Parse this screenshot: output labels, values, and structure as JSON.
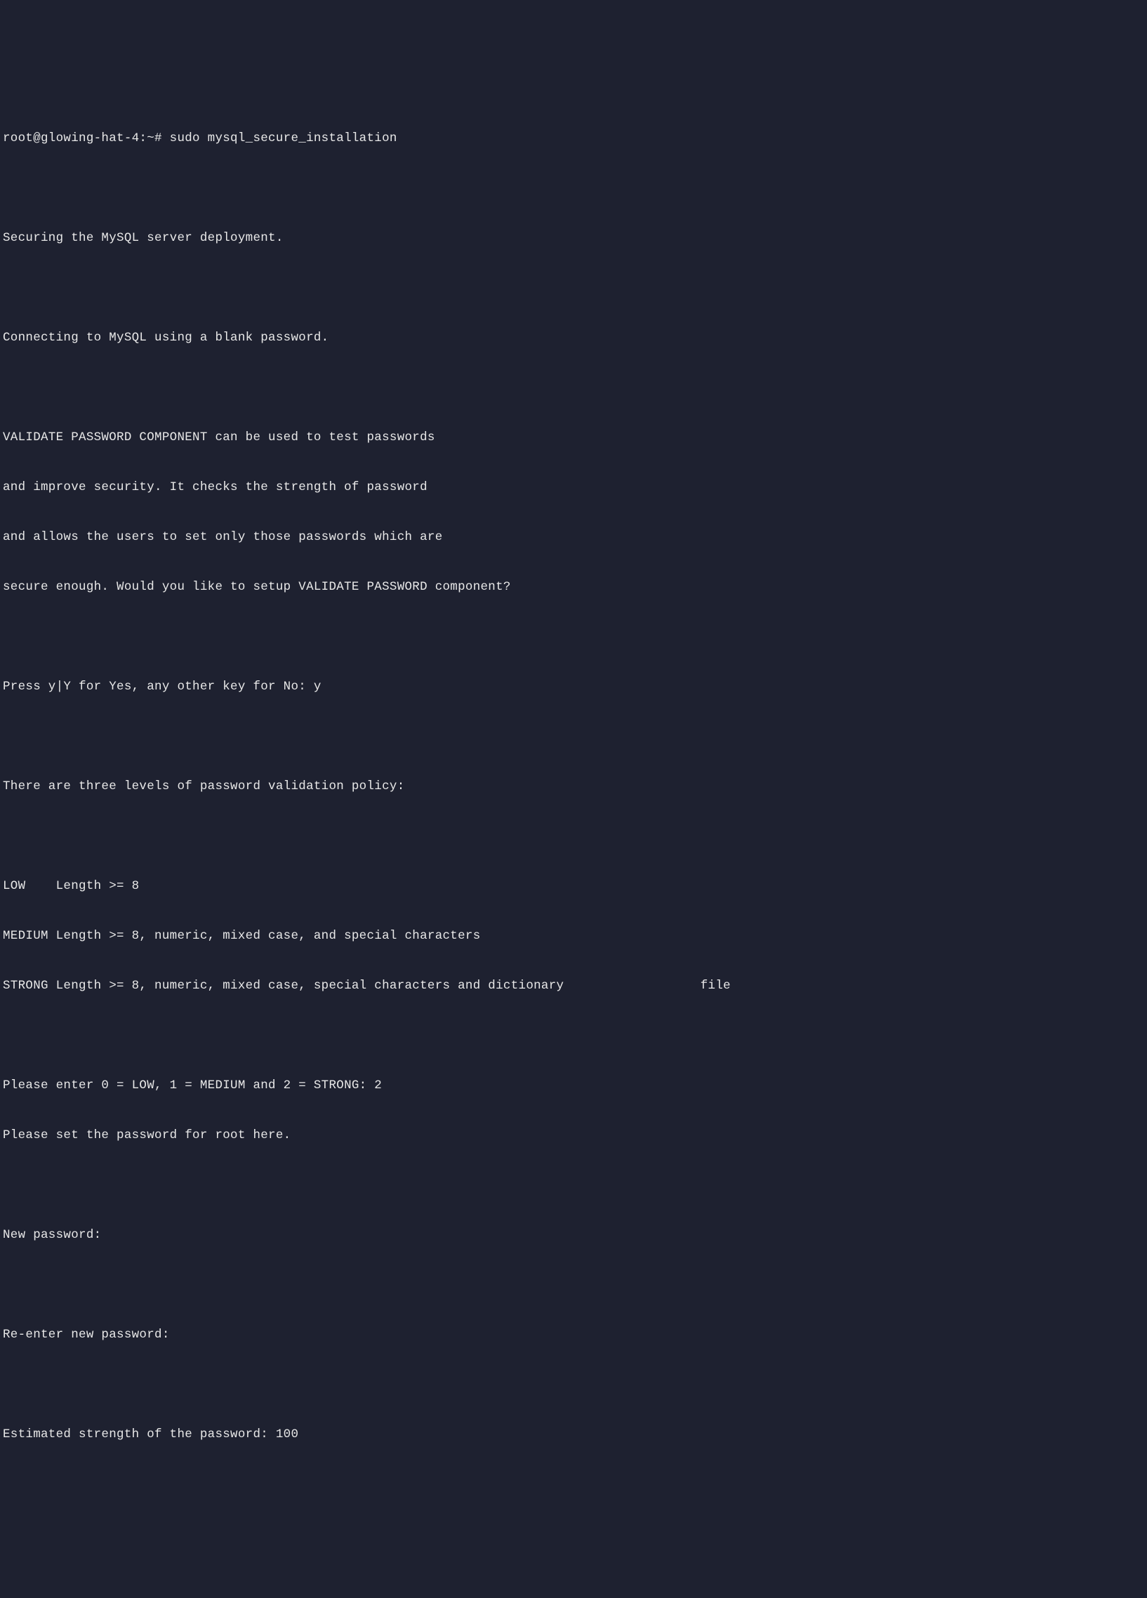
{
  "terminal": {
    "lines": [
      "root@glowing-hat-4:~# sudo mysql_secure_installation",
      "",
      "Securing the MySQL server deployment.",
      "",
      "Connecting to MySQL using a blank password.",
      "",
      "VALIDATE PASSWORD COMPONENT can be used to test passwords",
      "and improve security. It checks the strength of password",
      "and allows the users to set only those passwords which are",
      "secure enough. Would you like to setup VALIDATE PASSWORD component?",
      "",
      "Press y|Y for Yes, any other key for No: y",
      "",
      "There are three levels of password validation policy:",
      "",
      "LOW    Length >= 8",
      "MEDIUM Length >= 8, numeric, mixed case, and special characters",
      "STRONG Length >= 8, numeric, mixed case, special characters and dictionary                  file",
      "",
      "Please enter 0 = LOW, 1 = MEDIUM and 2 = STRONG: 2",
      "Please set the password for root here.",
      "",
      "New password:",
      "",
      "Re-enter new password:",
      "",
      "Estimated strength of the password: 100"
    ]
  }
}
